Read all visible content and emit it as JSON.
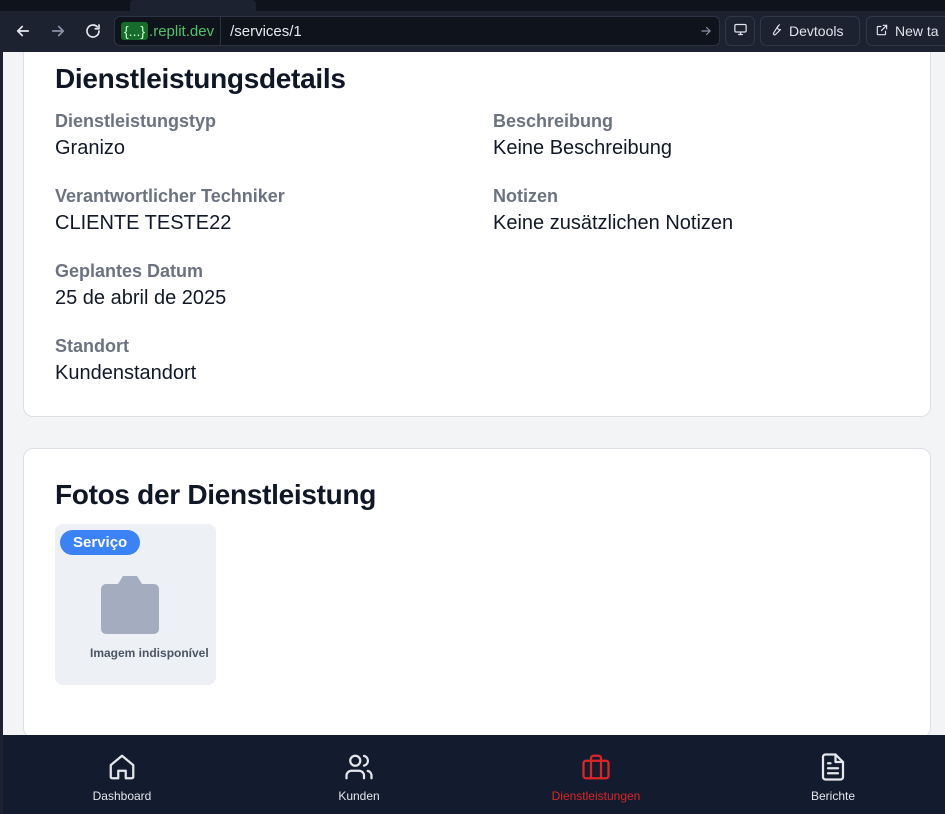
{
  "browser": {
    "url_host_braces": "{...}",
    "url_host": ".replit.dev",
    "url_path": "/services/1",
    "devtools_label": "Devtools",
    "newtab_label": "New ta"
  },
  "details": {
    "title": "Dienstleistungsdetails",
    "service_type_label": "Dienstleistungstyp",
    "service_type_value": "Granizo",
    "technician_label": "Verantwortlicher Techniker",
    "technician_value": "CLIENTE TESTE22",
    "date_label": "Geplantes Datum",
    "date_value": "25 de abril de 2025",
    "location_label": "Standort",
    "location_value": "Kundenstandort",
    "description_label": "Beschreibung",
    "description_value": "Keine Beschreibung",
    "notes_label": "Notizen",
    "notes_value": "Keine zusätzlichen Notizen"
  },
  "photos": {
    "title": "Fotos der Dienstleistung",
    "badge": "Serviço",
    "caption": "Imagem indisponível"
  },
  "bottom_nav": {
    "items": [
      {
        "label": "Dashboard",
        "icon": "home-icon"
      },
      {
        "label": "Kunden",
        "icon": "users-icon"
      },
      {
        "label": "Dienstleistungen",
        "icon": "briefcase-icon"
      },
      {
        "label": "Berichte",
        "icon": "file-text-icon"
      }
    ],
    "active_color": "#dc2626"
  }
}
